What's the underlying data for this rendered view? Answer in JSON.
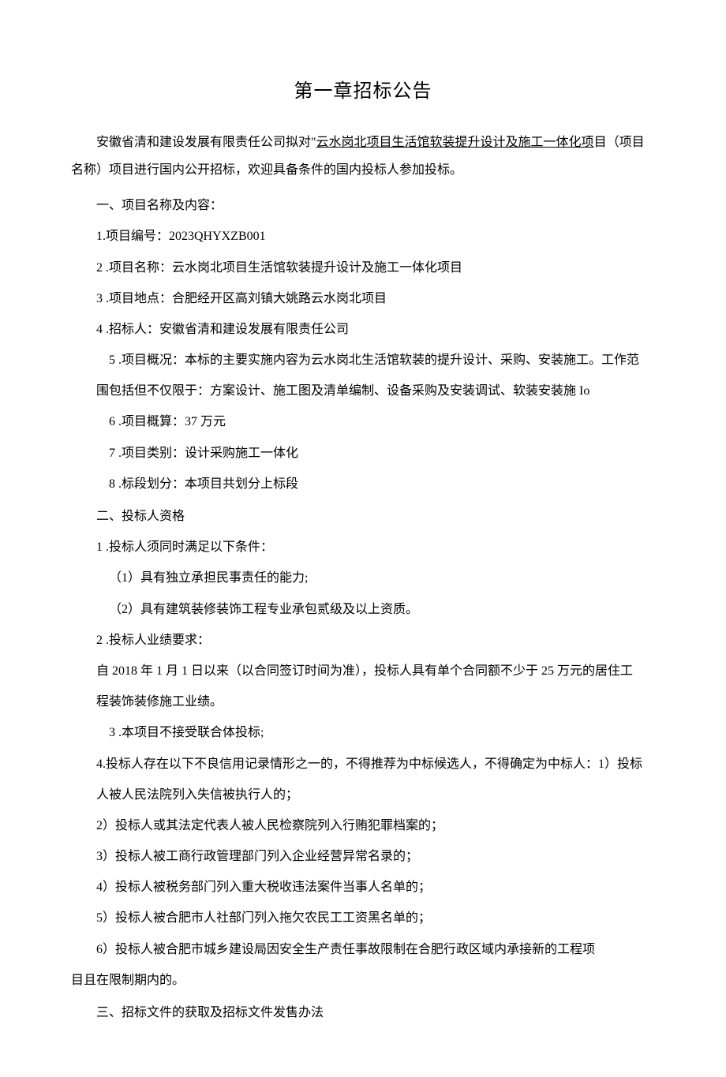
{
  "title": "第一章招标公告",
  "intro_prefix": "安徽省清和建设发展有限责任公司拟对\"",
  "intro_underlined": "云水岗北项目生活馆软装提升设计及施工一体化项",
  "intro_suffix": "目（项目名称）项目进行国内公开招标，欢迎具备条件的国内投标人参加投标。",
  "section1": {
    "header": "一、项目名称及内容：",
    "items": [
      "1.项目编号：2023QHYXZB001",
      "2 .项目名称：云水岗北项目生活馆软装提升设计及施工一体化项目",
      "3 .项目地点：合肥经开区高刘镇大姚路云水岗北项目",
      "4 .招标人：安徽省清和建设发展有限责任公司"
    ],
    "item5_line1": "5 .项目概况：本标的主要实施内容为云水岗北生活馆软装的提升设计、采购、安装施工。工作范",
    "item5_line2": "围包括但不仅限于：方案设计、施工图及清单编制、设备采购及安装调试、软装安装施 Io",
    "items_after": [
      "6 .项目概算：37 万元",
      "7 .项目类别：设计采购施工一体化",
      "8 .标段划分：本项目共划分上标段"
    ]
  },
  "section2": {
    "header": "二、投标人资格",
    "item1": "1 .投标人须同时满足以下条件：",
    "sub1": "（1）具有独立承担民事责任的能力;",
    "sub2": "（2）具有建筑装修装饰工程专业承包贰级及以上资质。",
    "item2": "2 .投标人业绩要求：",
    "req_line1": "自 2018 年 1 月 1 日以来（以合同签订时间为准），投标人具有单个合同额不少于 25 万元的居住工",
    "req_line2": "程装饰装修施工业绩。",
    "item3": "3 .本项目不接受联合体投标;",
    "item4_line1": "4.投标人存在以下不良信用记录情形之一的，不得推荐为中标候选人，不得确定为中标人：1）投标",
    "item4_line2": "人被人民法院列入失信被执行人的；",
    "sublist": [
      "2）投标人或其法定代表人被人民检察院列入行贿犯罪档案的；",
      "3）投标人被工商行政管理部门列入企业经营异常名录的；",
      "4）投标人被税务部门列入重大税收违法案件当事人名单的；",
      "5）投标人被合肥市人社部门列入拖欠农民工工资黑名单的；",
      "6）投标人被合肥市城乡建设局因安全生产责任事故限制在合肥行政区域内承接新的工程项"
    ],
    "tail": "目且在限制期内的。"
  },
  "section3": {
    "header": "三、招标文件的获取及招标文件发售办法"
  }
}
